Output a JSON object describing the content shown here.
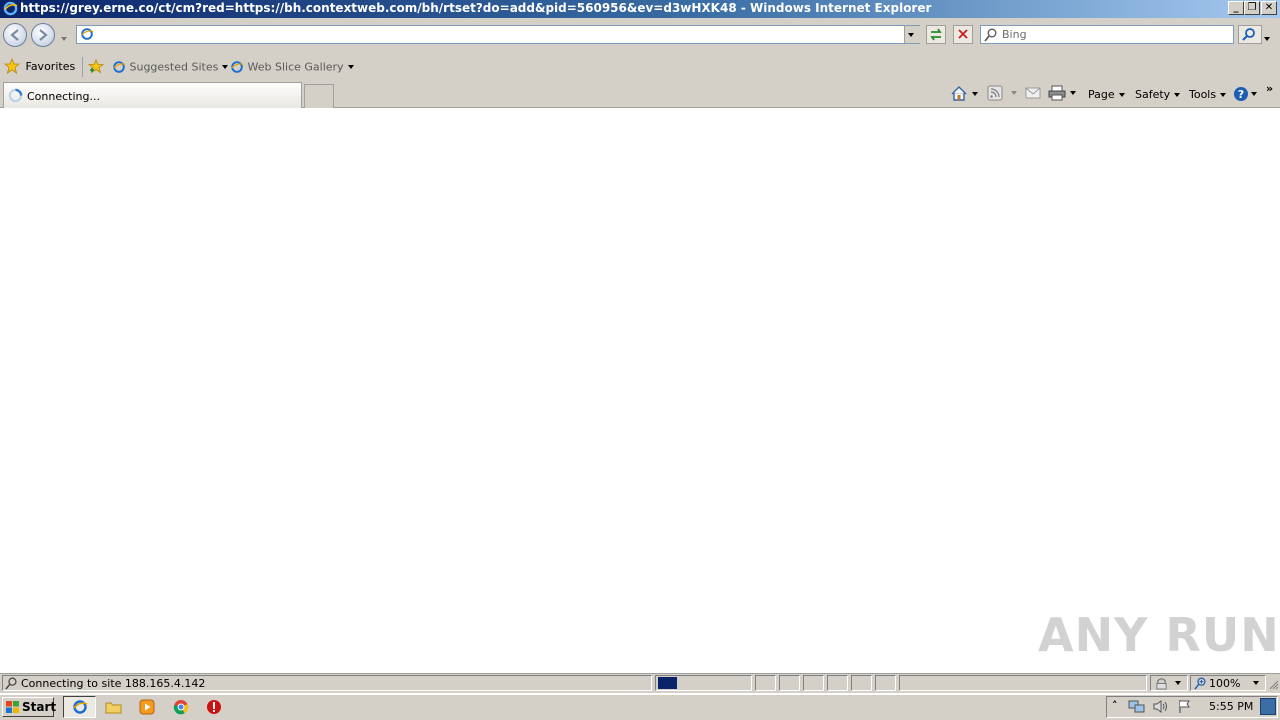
{
  "window": {
    "title": "https://grey.erne.co/ct/cm?red=https://bh.contextweb.com/bh/rtset?do=add&pid=560956&ev=d3wHXK48 - Windows Internet Explorer",
    "caption_minimize": "_",
    "caption_restore": "❐",
    "caption_close": "✕"
  },
  "address": {
    "value": ""
  },
  "search": {
    "placeholder": "Bing"
  },
  "favorites_bar": {
    "favorites_label": "Favorites",
    "items": [
      {
        "label": "Suggested Sites"
      },
      {
        "label": "Web Slice Gallery"
      }
    ]
  },
  "tab": {
    "label": "Connecting..."
  },
  "command_bar": {
    "page_label": "Page",
    "safety_label": "Safety",
    "tools_label": "Tools"
  },
  "status_bar": {
    "text": "Connecting to site 188.165.4.142",
    "zoom": "100%",
    "progress": 0.2
  },
  "taskbar": {
    "start_label": "Start",
    "clock": "5:55 PM"
  },
  "watermark": {
    "text": "ANY RUN"
  },
  "colors": {
    "titlebar_start": "#0a246a",
    "chrome": "#d4d0c8",
    "progress": "#0a246a"
  }
}
